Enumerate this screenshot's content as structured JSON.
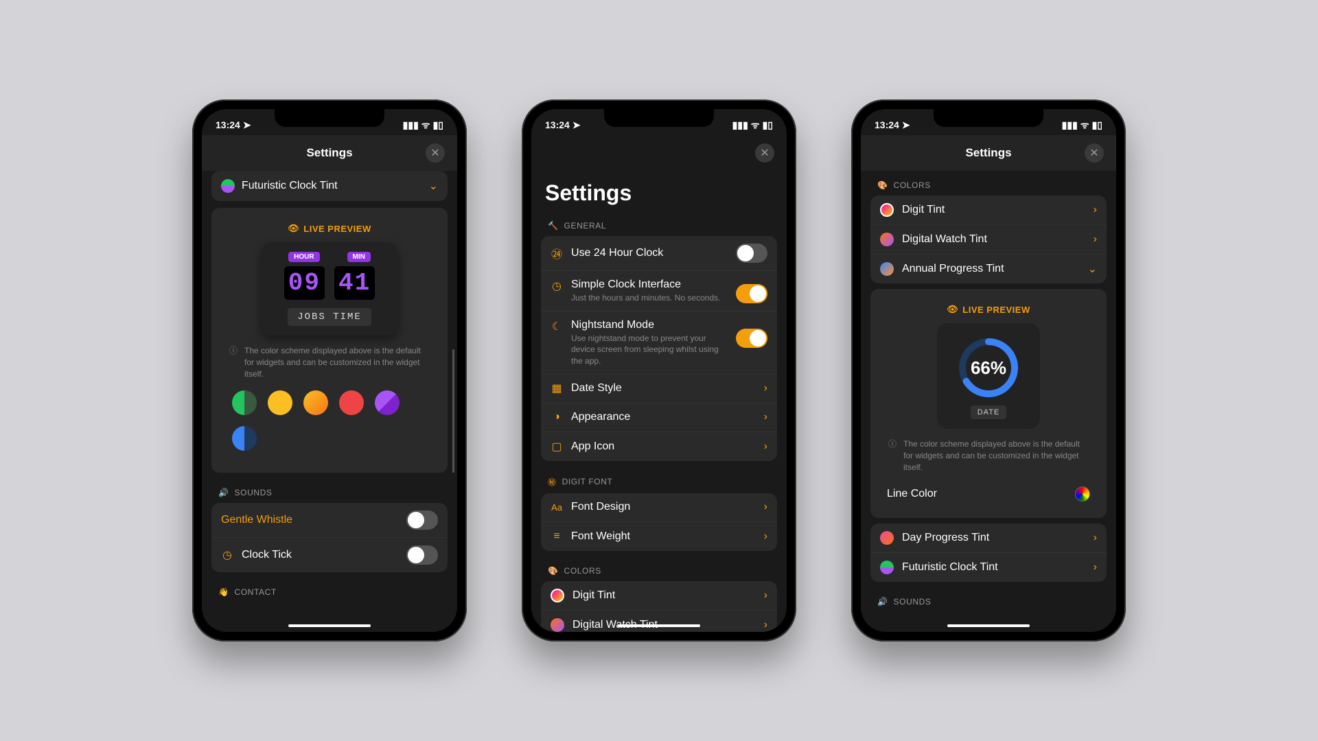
{
  "status": {
    "time": "13:24"
  },
  "phone1": {
    "headerTitle": "Settings",
    "expandLabel": "Futuristic Clock Tint",
    "livePreview": "LIVE PREVIEW",
    "hourTag": "HOUR",
    "minTag": "MIN",
    "hourDigits": "09",
    "minDigits": "41",
    "jobsTime": "JOBS TIME",
    "infoText": "The color scheme displayed above is the default for widgets and can be customized in the widget itself.",
    "soundsHeader": "SOUNDS",
    "soundRows": [
      {
        "label": "Gentle Whistle"
      },
      {
        "label": "Clock Tick"
      }
    ],
    "contactHeader": "CONTACT"
  },
  "phone2": {
    "bigTitle": "Settings",
    "generalHeader": "GENERAL",
    "general": [
      {
        "label": "Use 24 Hour Clock",
        "type": "toggle",
        "on": false
      },
      {
        "label": "Simple Clock Interface",
        "sub": "Just the hours and minutes. No seconds.",
        "type": "toggle",
        "on": true
      },
      {
        "label": "Nightstand Mode",
        "sub": "Use nightstand mode to prevent your device screen from sleeping whilst using the app.",
        "type": "toggle",
        "on": true
      },
      {
        "label": "Date Style",
        "type": "nav"
      },
      {
        "label": "Appearance",
        "type": "nav"
      },
      {
        "label": "App Icon",
        "type": "nav"
      }
    ],
    "fontHeader": "DIGIT FONT",
    "font": [
      {
        "label": "Font Design"
      },
      {
        "label": "Font Weight"
      }
    ],
    "colorsHeader": "COLORS",
    "colors": [
      {
        "label": "Digit Tint"
      },
      {
        "label": "Digital Watch Tint"
      }
    ]
  },
  "phone3": {
    "headerTitle": "Settings",
    "colorsHeader": "COLORS",
    "colorRows": [
      {
        "label": "Digit Tint"
      },
      {
        "label": "Digital Watch Tint"
      },
      {
        "label": "Annual Progress Tint"
      }
    ],
    "livePreview": "LIVE PREVIEW",
    "ringPercent": "66%",
    "dateTag": "DATE",
    "infoText": "The color scheme displayed above is the default for widgets and can be customized in the widget itself.",
    "lineColor": "Line Color",
    "extraRows": [
      {
        "label": "Day Progress Tint"
      },
      {
        "label": "Futuristic Clock Tint"
      }
    ],
    "soundsHeader": "SOUNDS"
  }
}
